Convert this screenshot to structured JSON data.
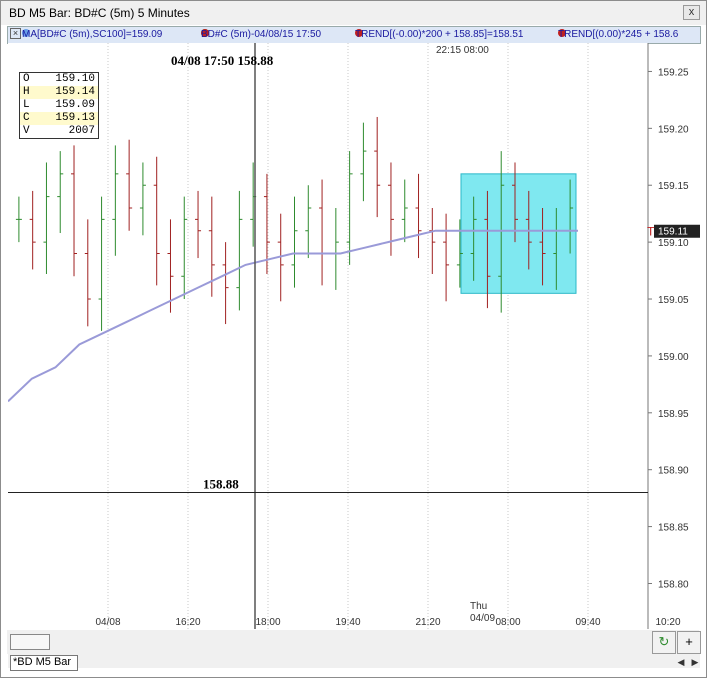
{
  "window": {
    "title": "BD M5 Bar: BD#C (5m) 5 Minutes",
    "close_glyph": "x"
  },
  "legend": {
    "items": [
      {
        "text": "MA[BD#C (5m),SC100]=159.09",
        "color": "#2020c0"
      },
      {
        "text": "BD#C (5m)-04/08/15 17:50",
        "color": "#cc2020"
      },
      {
        "text": "TREND[(-0.00)*200 + 158.85]=158.51",
        "color": "#cc2020"
      },
      {
        "text": "TREND[(0.00)*245 + 158.6",
        "color": "#cc2020"
      }
    ]
  },
  "cursor": {
    "label": "04/08 17:50  158.88",
    "time_top": "22:15   08:00",
    "price_label": "158.88",
    "y_value": 158.88
  },
  "ohlc": {
    "rows": [
      {
        "k": "O",
        "v": "159.10",
        "hl": false
      },
      {
        "k": "H",
        "v": "159.14",
        "hl": true
      },
      {
        "k": "L",
        "v": "159.09",
        "hl": false
      },
      {
        "k": "C",
        "v": "159.13",
        "hl": true
      },
      {
        "k": "V",
        "v": "2007",
        "hl": false
      }
    ]
  },
  "chart_data": {
    "type": "ohlc-bar",
    "ylim": [
      158.76,
      159.275
    ],
    "yticks": [
      "159.25",
      "159.20",
      "159.15",
      "159.10",
      "159.05",
      "159.00",
      "158.95",
      "158.90",
      "158.85",
      "158.80"
    ],
    "xticks": [
      "04/08",
      "16:20",
      "18:00",
      "19:40",
      "21:20",
      "08:00",
      "09:40",
      "10:20"
    ],
    "day_label": "Thu\n04/09",
    "last_price": "159.11",
    "ma_series": [
      158.96,
      158.98,
      158.99,
      159.01,
      159.02,
      159.03,
      159.04,
      159.05,
      159.06,
      159.07,
      159.08,
      159.085,
      159.09,
      159.09,
      159.09,
      159.095,
      159.1,
      159.105,
      159.11,
      159.11,
      159.11,
      159.11,
      159.11,
      159.11,
      159.11
    ],
    "bars_close": [
      159.12,
      159.1,
      159.14,
      159.16,
      159.09,
      159.05,
      159.12,
      159.16,
      159.13,
      159.15,
      159.09,
      159.07,
      159.12,
      159.11,
      159.08,
      159.06,
      159.12,
      159.14,
      159.1,
      159.08,
      159.11,
      159.13,
      159.09,
      159.1,
      159.16,
      159.18,
      159.15,
      159.12,
      159.13,
      159.11,
      159.1,
      159.08,
      159.09,
      159.12,
      159.07,
      159.15,
      159.12,
      159.1,
      159.09,
      159.11,
      159.13
    ]
  },
  "bottom": {
    "tab_label": "*BD M5 Bar",
    "refresh_glyph": "↻",
    "plus_glyph": "+"
  }
}
